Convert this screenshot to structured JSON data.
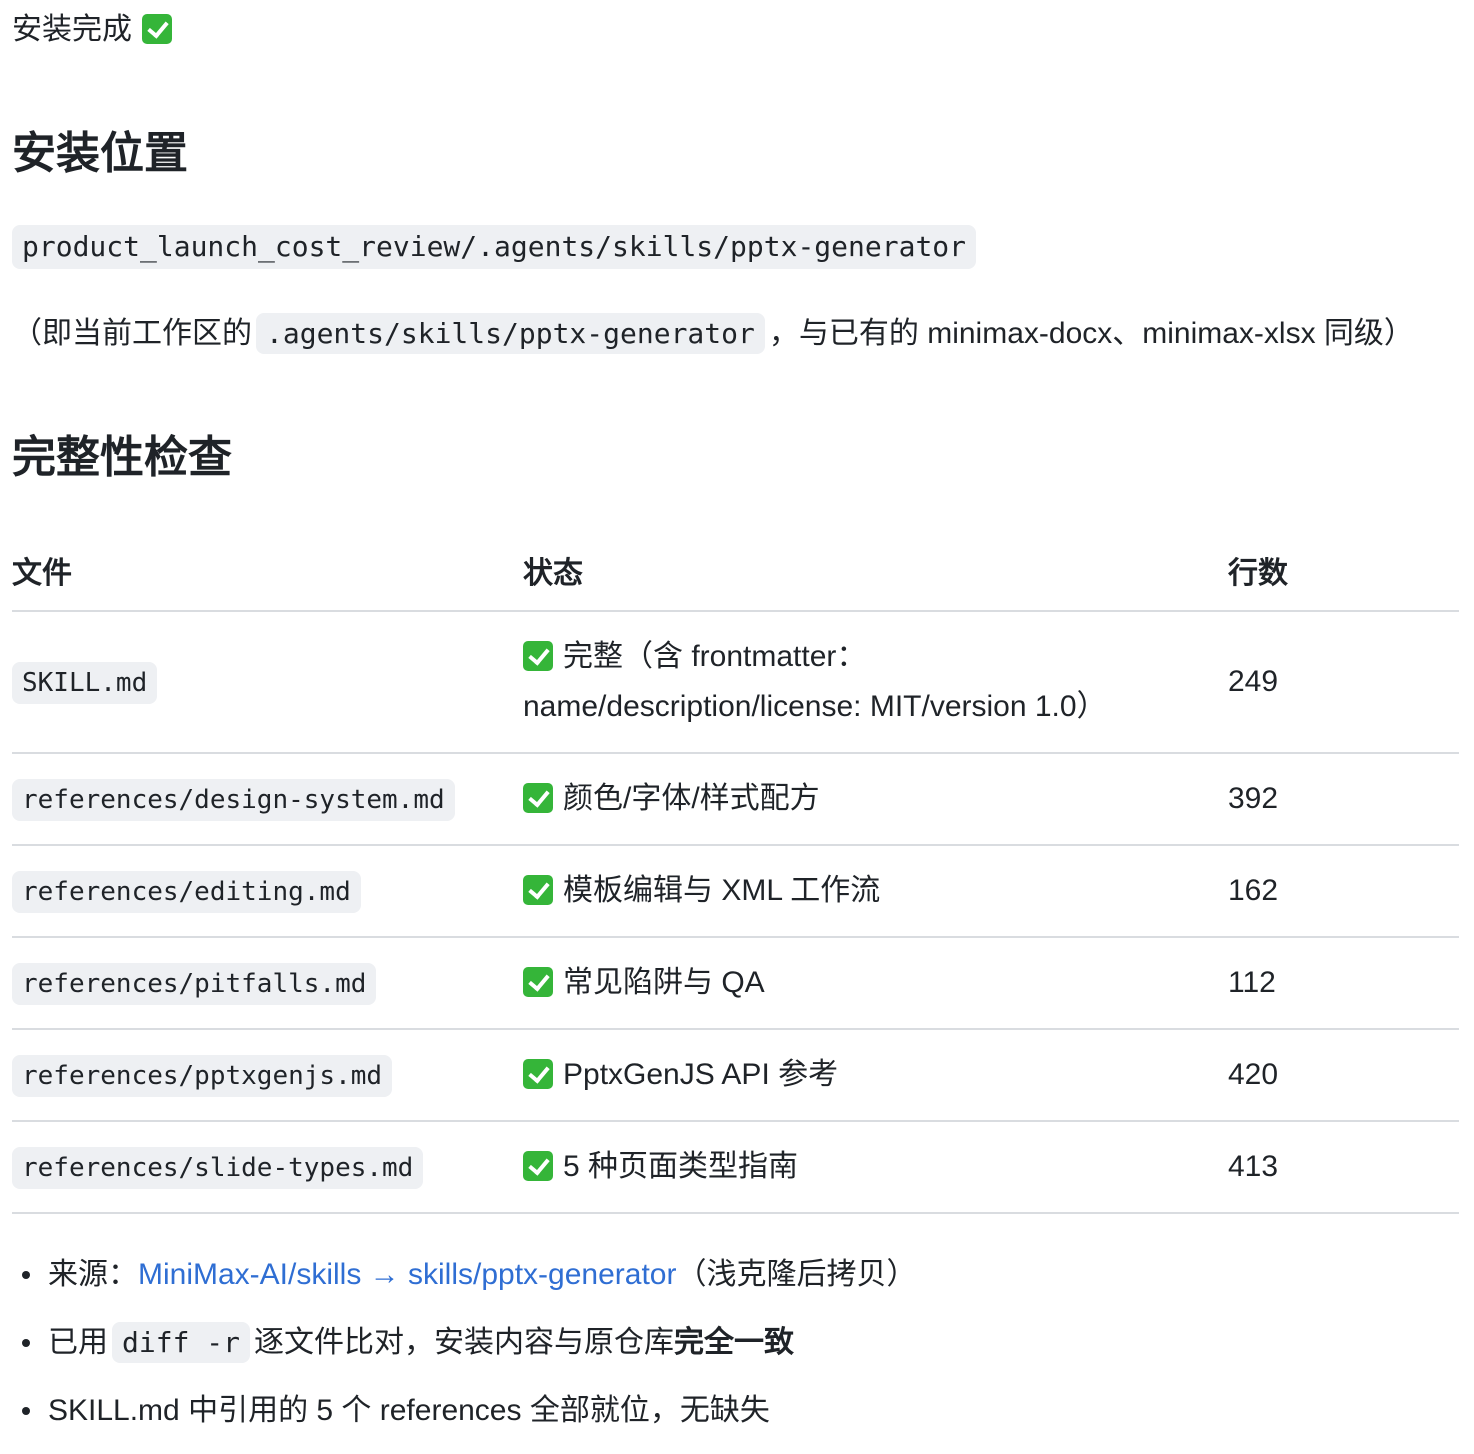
{
  "status": {
    "text": "安装完成",
    "icon": "check-mark-button-icon"
  },
  "install_location": {
    "heading": "安装位置",
    "path": "product_launch_cost_review/.agents/skills/pptx-generator",
    "note_prefix": "（即当前工作区的",
    "note_code": ".agents/skills/pptx-generator",
    "note_suffix": "，与已有的 minimax-docx、minimax-xlsx 同级）"
  },
  "integrity": {
    "heading": "完整性检查",
    "columns": [
      "文件",
      "状态",
      "行数"
    ],
    "rows": [
      {
        "file": "SKILL.md",
        "status_line1": "完整（含 frontmatter：",
        "status_line2": "name/description/license: MIT/version 1.0）",
        "lines": "249"
      },
      {
        "file": "references/design-system.md",
        "status": "颜色/字体/样式配方",
        "lines": "392"
      },
      {
        "file": "references/editing.md",
        "status": "模板编辑与 XML 工作流",
        "lines": "162"
      },
      {
        "file": "references/pitfalls.md",
        "status": "常见陷阱与 QA",
        "lines": "112"
      },
      {
        "file": "references/pptxgenjs.md",
        "status": "PptxGenJS API 参考",
        "lines": "420"
      },
      {
        "file": "references/slide-types.md",
        "status": "5 种页面类型指南",
        "lines": "413"
      }
    ]
  },
  "bullets": {
    "source_label": "来源：",
    "source_link": "MiniMax-AI/skills → skills/pptx-generator",
    "source_suffix": "（浅克隆后拷贝）",
    "diff_prefix": "已用",
    "diff_code": "diff -r",
    "diff_middle": "逐文件比对，安装内容与原仓库",
    "diff_bold": "完全一致",
    "refs_text": "SKILL.md 中引用的 5 个 references 全部就位，无缺失"
  },
  "colors": {
    "link": "#2f6ed3",
    "check": "#35b539",
    "code_bg": "#eef0f3"
  }
}
